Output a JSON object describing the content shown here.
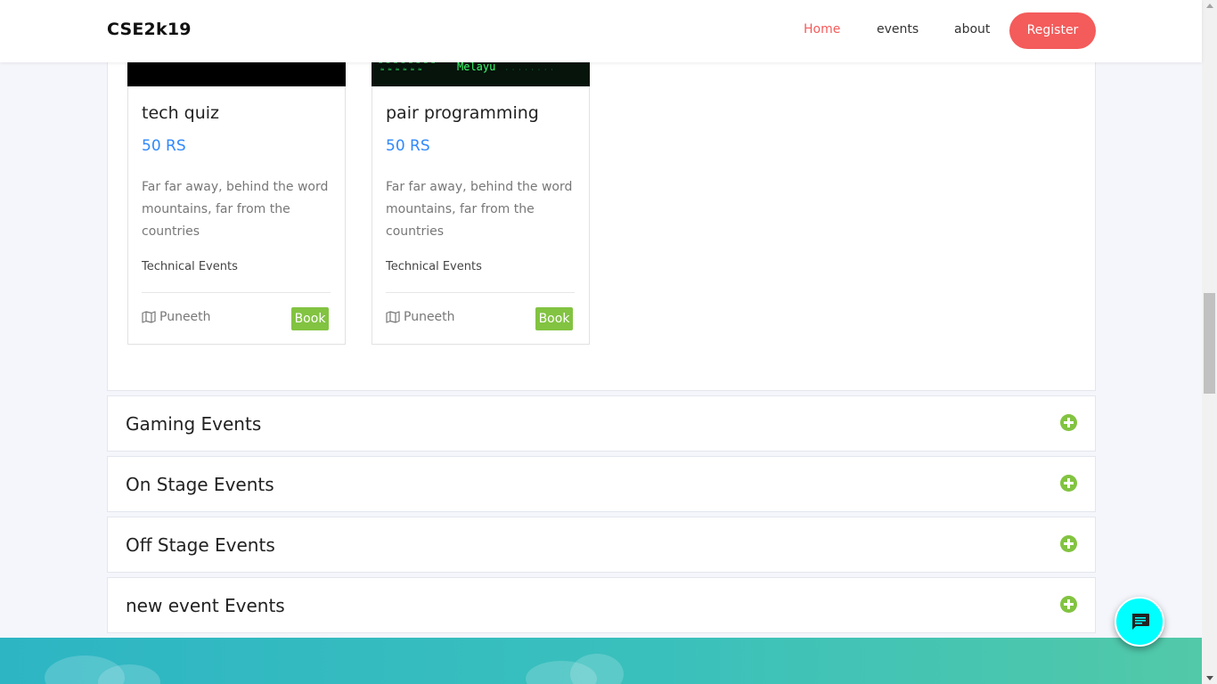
{
  "navbar": {
    "brand": "CSE2k19",
    "links": [
      {
        "label": "Home",
        "active": true
      },
      {
        "label": "events",
        "active": false
      },
      {
        "label": "about",
        "active": false
      }
    ],
    "register_label": "Register"
  },
  "technical_events": {
    "cards": [
      {
        "title": "tech quiz",
        "price": "50 RS",
        "description": "Far far away, behind the word mountains, far from the countries",
        "category": "Technical Events",
        "organizer": "Puneeth",
        "book_label": "Book"
      },
      {
        "title": "pair programming",
        "price": "50 RS",
        "description": "Far far away, behind the word mountains, far from the countries",
        "category": "Technical Events",
        "organizer": "Puneeth",
        "book_label": "Book",
        "image_text": "Melayu"
      }
    ]
  },
  "accordion": [
    {
      "title": "Gaming Events"
    },
    {
      "title": "On Stage Events"
    },
    {
      "title": "Off Stage Events"
    },
    {
      "title": "new event Events"
    }
  ],
  "colors": {
    "accent": "#f45b5b",
    "price": "#2f89fc",
    "book": "#82c341",
    "chat": "#00ffff"
  },
  "icons": [
    "map-icon",
    "plus-circle-icon",
    "chat-icon"
  ]
}
